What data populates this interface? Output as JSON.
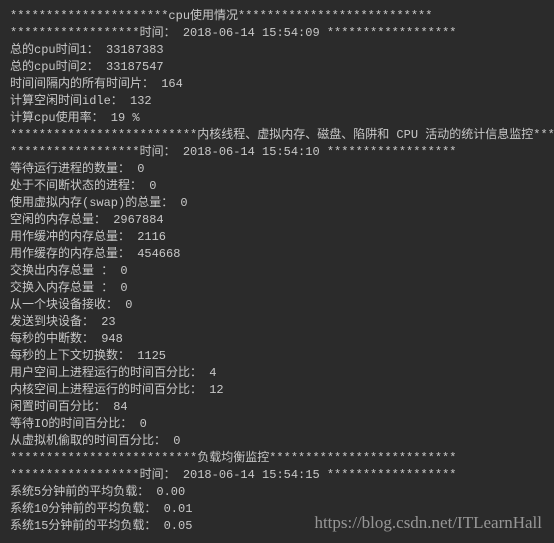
{
  "cpu": {
    "header": "**********************cpu使用情况***************************",
    "time_header": "******************时间：  2018-06-14 15:54:09 ******************",
    "total_time_1": "总的cpu时间1： 33187383",
    "total_time_2": "总的cpu时间2： 33187547",
    "interval_slices": "时间间隔内的所有时间片： 164",
    "idle_time": "计算空闲时间idle： 132",
    "usage_rate": "计算cpu使用率：  19 %"
  },
  "stats": {
    "header": "**************************内核线程、虚拟内存、磁盘、陷阱和 CPU 活动的统计信息监控**************************",
    "time_header": "******************时间：  2018-06-14 15:54:10 ******************",
    "waiting_procs": "等待运行进程的数量： 0",
    "uninterruptible_procs": "处于不间断状态的进程： 0",
    "swap_total": "使用虚拟内存(swap)的总量： 0",
    "free_mem": "空闲的内存总量： 2967884",
    "buffer_mem": "用作缓冲的内存总量： 2116",
    "cache_mem": "用作缓存的内存总量： 454668",
    "swap_out": "交换出内存总量 ： 0",
    "swap_in": "交换入内存总量 ： 0",
    "blk_recv": "从一个块设备接收： 0",
    "blk_send": "发送到块设备： 23",
    "interrupts": "每秒的中断数： 948",
    "ctx_switch": "每秒的上下文切换数： 1125",
    "user_time": "用户空间上进程运行的时间百分比： 4",
    "kernel_time": "内核空间上进程运行的时间百分比： 12",
    "idle_pct": "闲置时间百分比： 84",
    "io_wait_pct": "等待IO的时间百分比： 0",
    "vm_steal_pct": "从虚拟机偷取的时间百分比： 0"
  },
  "load": {
    "header": "**************************负载均衡监控**************************",
    "time_header": "******************时间：  2018-06-14 15:54:15 ******************",
    "avg5": "系统5分钟前的平均负载：  0.00",
    "avg10": "系统10分钟前的平均负载：  0.01",
    "avg15": "系统15分钟前的平均负载：  0.05"
  },
  "watermark": "https://blog.csdn.net/ITLearnHall"
}
